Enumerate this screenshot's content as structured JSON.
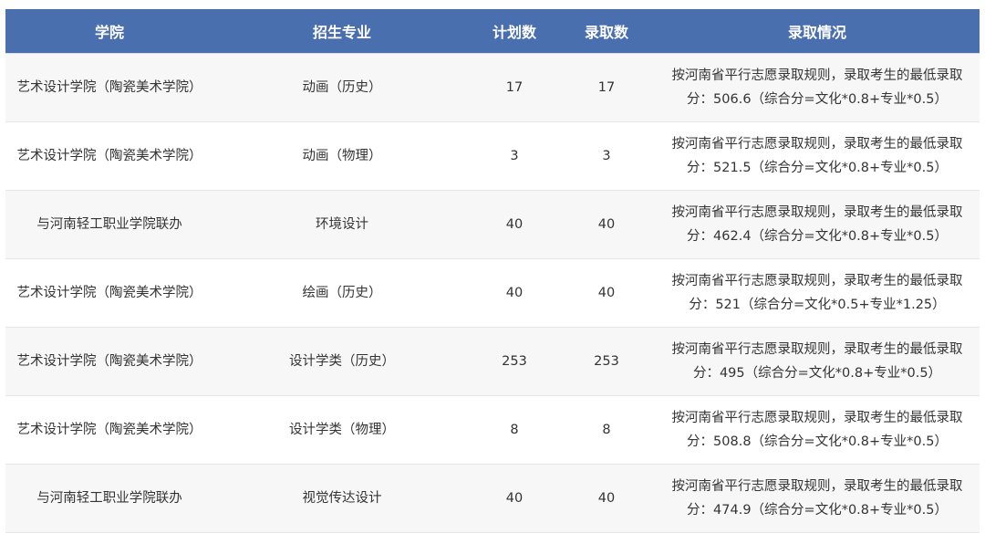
{
  "table": {
    "headers": [
      "学院",
      "招生专业",
      "计划数",
      "录取数",
      "录取情况"
    ],
    "rows": [
      {
        "college": "艺术设计学院（陶瓷美术学院）",
        "major": "动画（历史）",
        "plan": "17",
        "admitted": "17",
        "status": "按河南省平行志愿录取规则，录取考生的最低录取分：506.6（综合分=文化*0.8+专业*0.5）"
      },
      {
        "college": "艺术设计学院（陶瓷美术学院）",
        "major": "动画（物理）",
        "plan": "3",
        "admitted": "3",
        "status": "按河南省平行志愿录取规则，录取考生的最低录取分：521.5（综合分=文化*0.8+专业*0.5）"
      },
      {
        "college": "与河南轻工职业学院联办",
        "major": "环境设计",
        "plan": "40",
        "admitted": "40",
        "status": "按河南省平行志愿录取规则，录取考生的最低录取分：462.4（综合分=文化*0.8+专业*0.5）"
      },
      {
        "college": "艺术设计学院（陶瓷美术学院）",
        "major": "绘画（历史）",
        "plan": "40",
        "admitted": "40",
        "status": "按河南省平行志愿录取规则，录取考生的最低录取分：521（综合分=文化*0.5+专业*1.25）"
      },
      {
        "college": "艺术设计学院（陶瓷美术学院）",
        "major": "设计学类（历史）",
        "plan": "253",
        "admitted": "253",
        "status": "按河南省平行志愿录取规则，录取考生的最低录取分：495（综合分=文化*0.8+专业*0.5）"
      },
      {
        "college": "艺术设计学院（陶瓷美术学院）",
        "major": "设计学类（物理）",
        "plan": "8",
        "admitted": "8",
        "status": "按河南省平行志愿录取规则，录取考生的最低录取分：508.8（综合分=文化*0.8+专业*0.5）"
      },
      {
        "college": "与河南轻工职业学院联办",
        "major": "视觉传达设计",
        "plan": "40",
        "admitted": "40",
        "status": "按河南省平行志愿录取规则，录取考生的最低录取分：474.9（综合分=文化*0.8+专业*0.5）"
      }
    ]
  },
  "colors": {
    "header_bg": "#4a6fae",
    "header_text": "#ffffff",
    "row_odd_bg": "#f7f7f7",
    "row_even_bg": "#ffffff",
    "body_text": "#333333"
  }
}
